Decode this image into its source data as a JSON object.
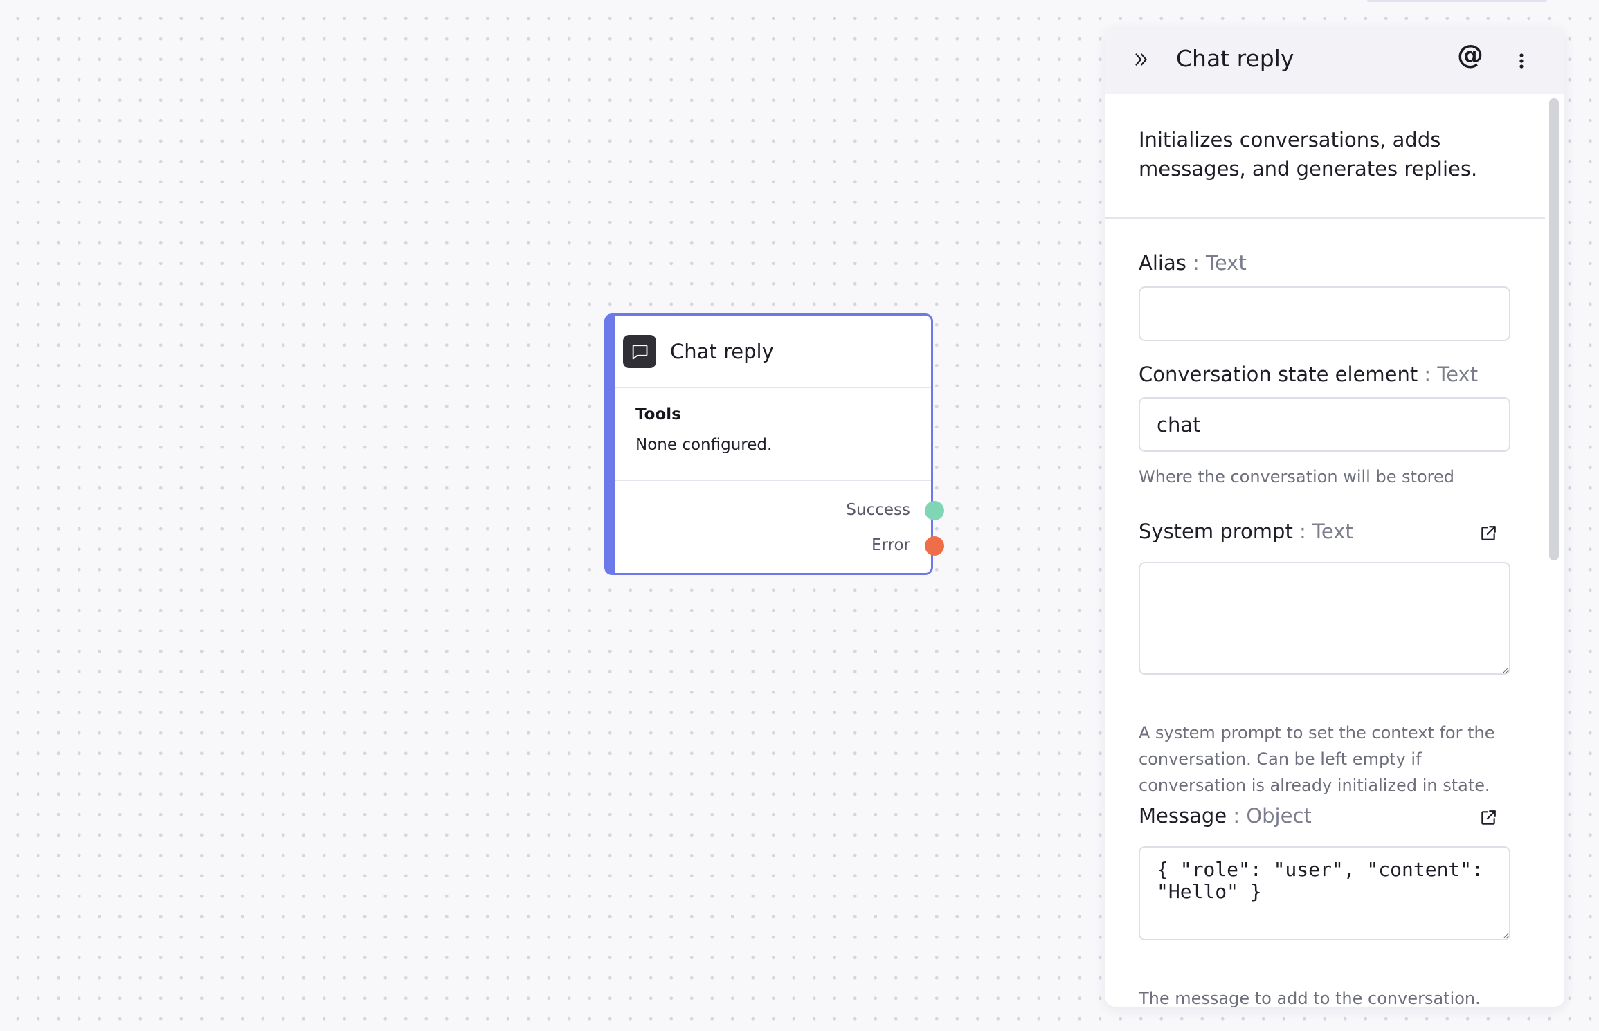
{
  "node": {
    "title": "Chat reply",
    "icon": "chat-bubble-icon",
    "tools_label": "Tools",
    "tools_value": "None configured.",
    "outputs": [
      {
        "label": "Success",
        "color": "#7fd6b4"
      },
      {
        "label": "Error",
        "color": "#ef6e49"
      }
    ],
    "accent_color": "#6b79e9"
  },
  "panel": {
    "title": "Chat reply",
    "mention_symbol": "@",
    "description": "Initializes conversations, adds messages, and generates replies.",
    "fields": {
      "alias": {
        "label": "Alias",
        "type": " : Text",
        "value": ""
      },
      "conversation_state": {
        "label": "Conversation state element",
        "type": " : Text",
        "value": "chat",
        "help": "Where the conversation will be stored"
      },
      "system_prompt": {
        "label": "System prompt",
        "type": " : Text",
        "value": "",
        "help": "A system prompt to set the context for the conversation. Can be left empty if conversation is already initialized in state."
      },
      "message": {
        "label": "Message",
        "type": " : Object",
        "value": "{ \"role\": \"user\", \"content\": \"Hello\" }",
        "help": "The message to add to the conversation. Must be an object including role and"
      }
    }
  }
}
